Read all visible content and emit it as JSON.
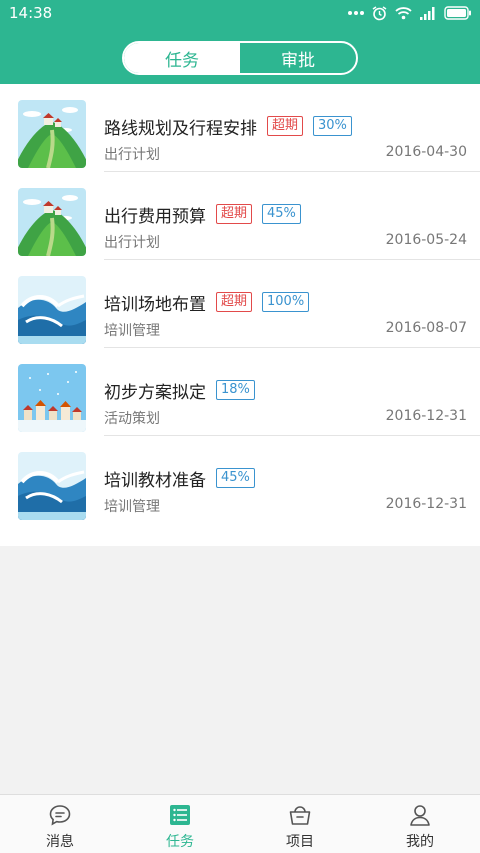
{
  "status_bar": {
    "time": "14:38"
  },
  "header": {
    "tabs": [
      {
        "label": "任务",
        "active": true
      },
      {
        "label": "审批",
        "active": false
      }
    ]
  },
  "tasks": [
    {
      "title": "路线规划及行程安排",
      "overdue": "超期",
      "progress": "30%",
      "category": "出行计划",
      "date": "2016-04-30",
      "thumb": "hill"
    },
    {
      "title": "出行费用预算",
      "overdue": "超期",
      "progress": "45%",
      "category": "出行计划",
      "date": "2016-05-24",
      "thumb": "hill"
    },
    {
      "title": "培训场地布置",
      "overdue": "超期",
      "progress": "100%",
      "category": "培训管理",
      "date": "2016-08-07",
      "thumb": "wave"
    },
    {
      "title": "初步方案拟定",
      "overdue": "",
      "progress": "18%",
      "category": "活动策划",
      "date": "2016-12-31",
      "thumb": "town"
    },
    {
      "title": "培训教材准备",
      "overdue": "",
      "progress": "45%",
      "category": "培训管理",
      "date": "2016-12-31",
      "thumb": "wave"
    }
  ],
  "bottom_nav": [
    {
      "label": "消息",
      "icon": "chat-icon",
      "active": false
    },
    {
      "label": "任务",
      "icon": "task-list-icon",
      "active": true
    },
    {
      "label": "项目",
      "icon": "basket-icon",
      "active": false
    },
    {
      "label": "我的",
      "icon": "person-icon",
      "active": false
    }
  ],
  "colors": {
    "brand": "#2db691",
    "overdue": "#e24a4a",
    "progress": "#3a93cf"
  }
}
